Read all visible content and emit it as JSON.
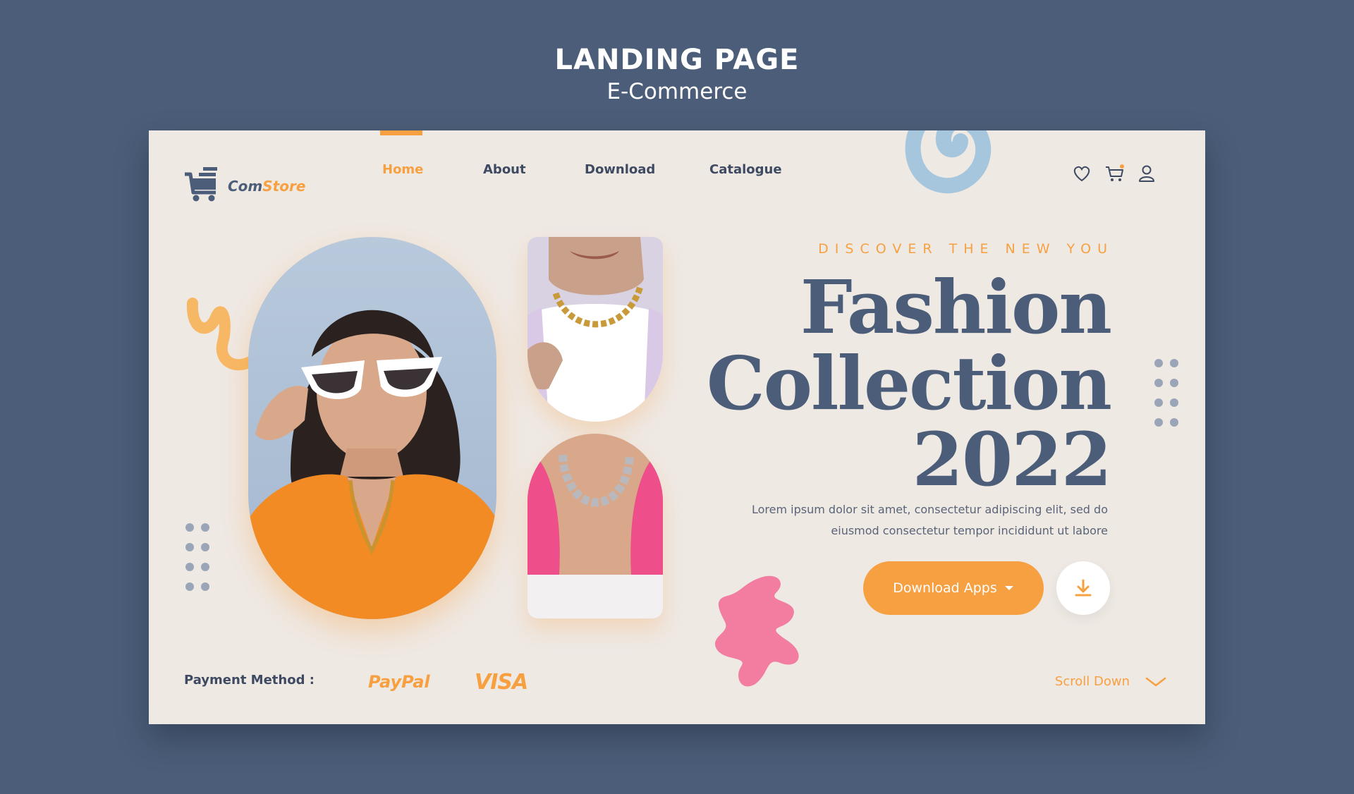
{
  "header": {
    "title": "LANDING PAGE",
    "subtitle": "E-Commerce"
  },
  "brand": {
    "name_part1": "Com",
    "name_part2": "Store",
    "icon": "shopping-cart-icon"
  },
  "nav": {
    "items": [
      {
        "label": "Home",
        "active": true
      },
      {
        "label": "About",
        "active": false
      },
      {
        "label": "Download",
        "active": false
      },
      {
        "label": "Catalogue",
        "active": false
      }
    ]
  },
  "header_icons": [
    "heart-icon",
    "cart-icon",
    "user-icon"
  ],
  "hero": {
    "tagline": "DISCOVER THE NEW YOU",
    "headline_line1": "Fashion",
    "headline_line2": "Collection",
    "headline_line3": "2022",
    "description_line1": "Lorem ipsum dolor sit amet, consectetur adipiscing elit, sed do",
    "description_line2": "eiusmod consectetur tempor incididunt ut labore",
    "cta_label": "Download Apps",
    "cta_icon": "caret-down-icon",
    "secondary_icon": "download-icon"
  },
  "footer": {
    "payment_label": "Payment Method :",
    "payment_methods": [
      "PayPal",
      "VISA"
    ],
    "scroll_label": "Scroll Down",
    "scroll_icon": "chevron-down-icon"
  },
  "colors": {
    "background": "#4b5d78",
    "card": "#efe9e4",
    "accent": "#f7a042",
    "heading": "#4b5d78",
    "blue_swirl": "#a5c6dd",
    "pink_blob": "#f27da0"
  }
}
